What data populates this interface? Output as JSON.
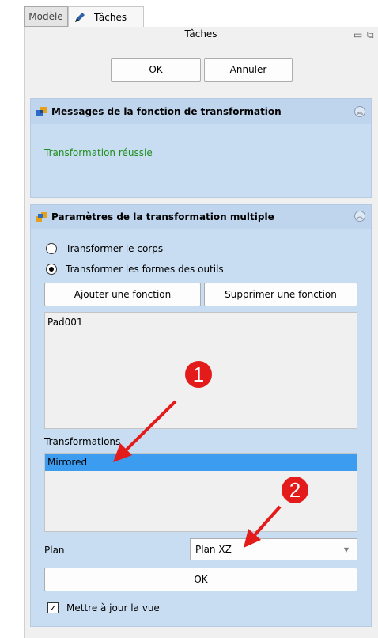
{
  "tabs": {
    "model_label": "Modèle",
    "tasks_label": "Tâches"
  },
  "dock": {
    "title": "Tâches"
  },
  "dialog": {
    "ok_label": "OK",
    "cancel_label": "Annuler"
  },
  "messages": {
    "title": "Messages de la fonction de transformation",
    "status_text": "Transformation réussie",
    "status_color": "#1e8f1e"
  },
  "params": {
    "title": "Paramètres de la transformation multiple",
    "radio_body": "Transformer le corps",
    "radio_tools": "Transformer les formes des outils",
    "add_feature": "Ajouter une fonction",
    "remove_feature": "Supprimer une fonction",
    "features": [
      "Pad001"
    ],
    "transformations_label": "Transformations",
    "transformations": [
      "Mirrored"
    ],
    "selection_color": "#3c9cf0",
    "plane_label": "Plan",
    "plane_value": "Plan XZ",
    "ok_label": "OK",
    "update_view_label": "Mettre à jour la vue"
  },
  "annotations": [
    "1",
    "2"
  ],
  "annotation_color": "#e31b1b"
}
